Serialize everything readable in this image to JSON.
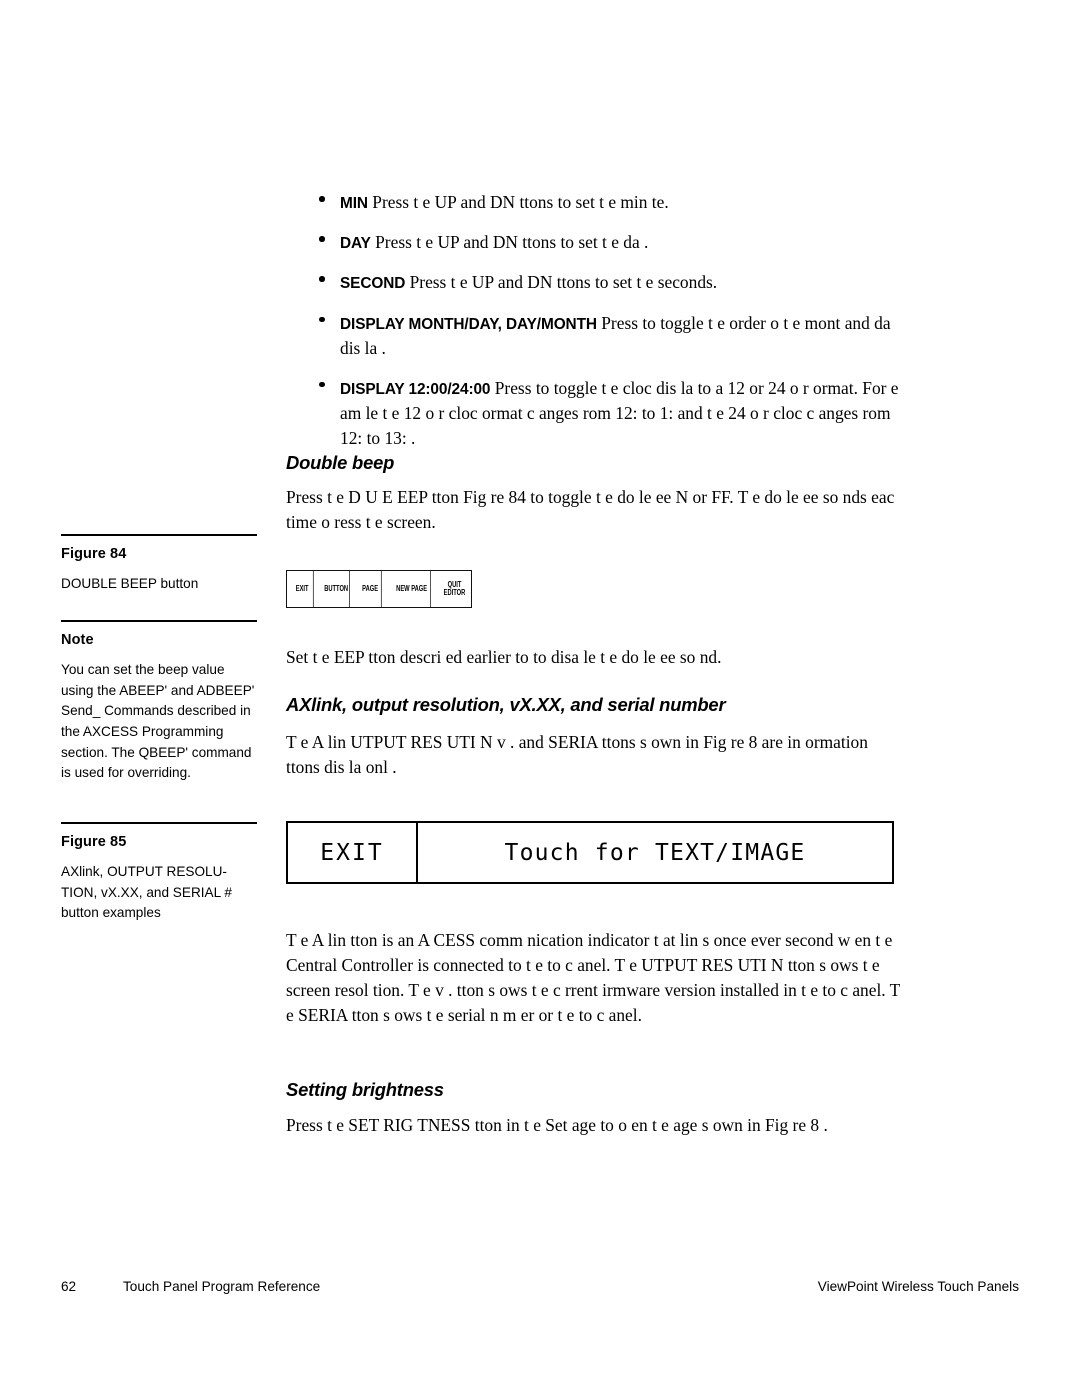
{
  "document": {
    "bullets": [
      {
        "label": "MIN",
        "text": "Press t e UP and DN    ttons to set t e min te."
      },
      {
        "label": "DAY",
        "text": "Press t e UP and DN    ttons to set t e da ."
      },
      {
        "label": "SECOND",
        "text": "Press t e UP and DN    ttons to set t e seconds."
      },
      {
        "label": "DISPLAY MONTH/DAY, DAY/MONTH",
        "text": "Press to toggle t e order o  t e mont  and da  dis la ."
      },
      {
        "label": "DISPLAY 12:00/24:00",
        "text": "Press to toggle t e cloc  dis la  to a 12  or 24   o r  ormat. For e am le t e 12  o r cloc   ormat c anges  rom 12:   to 1:   and t e 24  o r cloc  c anges  rom 12:   to 13:  ."
      }
    ],
    "section_double_beep": {
      "heading": "Double beep",
      "paragraph": "Press t e D U  E  EEP   tton  Fig re 84  to toggle t e do  le  ee    N or   FF. T e do  le  ee  so nds eac  time  o   ress t e screen.",
      "paragraph_after": "Set t e  EEP   tton  descri ed earlier  to  to disa le t e do  le  ee  so nd."
    },
    "section_axlink": {
      "heading": "AXlink, output resolution, vX.XX, and serial number",
      "paragraph_intro": "T e A lin    UTPUT RES  UTI N  v .    and SERIA       ttons s own in Fig re 8  are in ormation   ttons  dis la  onl .",
      "paragraph_body": "T e A lin    tton is an A CESS comm nication indicator t at  lin s once ever  second w en t e Central Controller is connected to t e to c   anel. T e  UTPUT RES  UTI N   tton s ows t e screen resol tion. T e v .      tton s ows t e c rrent  irmware version installed in t e to c   anel. T e SERIA      tton s ows t e serial n m er  or t e to c   anel."
    },
    "section_brightness": {
      "heading": "Setting brightness",
      "paragraph": "Press t e SET  RIG  TNESS   tton in t e Set    age to o en t e  age s own in Fig re 8 ."
    },
    "sidebar": [
      {
        "title": "Figure 84",
        "body": "DOUBLE BEEP button"
      },
      {
        "title": "Note",
        "body": "You can set the beep value using the  ABEEP' and  ADBEEP' Send_ Commands described in the AXCESS Programming section. The  QBEEP' command is used for overriding."
      },
      {
        "title": "Figure 85",
        "body": "AXlink, OUTPUT RESOLU-TION, vX.XX, and SERIAL # button examples"
      }
    ],
    "figure84_buttons": [
      {
        "name": "exit",
        "label": "EXIT"
      },
      {
        "name": "button",
        "label": "BUTTON"
      },
      {
        "name": "page",
        "label": "PAGE"
      },
      {
        "name": "new-page",
        "label": "NEW PAGE"
      },
      {
        "name": "quit-editor",
        "label": "QUIT\nEDITOR"
      }
    ],
    "figure85_touchbar": {
      "exit_label": "EXIT",
      "main_label": "Touch for TEXT/IMAGE"
    },
    "footer": {
      "page_number": "62",
      "left": "Touch Panel Program Reference",
      "right": "ViewPoint Wireless Touch Panels"
    }
  }
}
